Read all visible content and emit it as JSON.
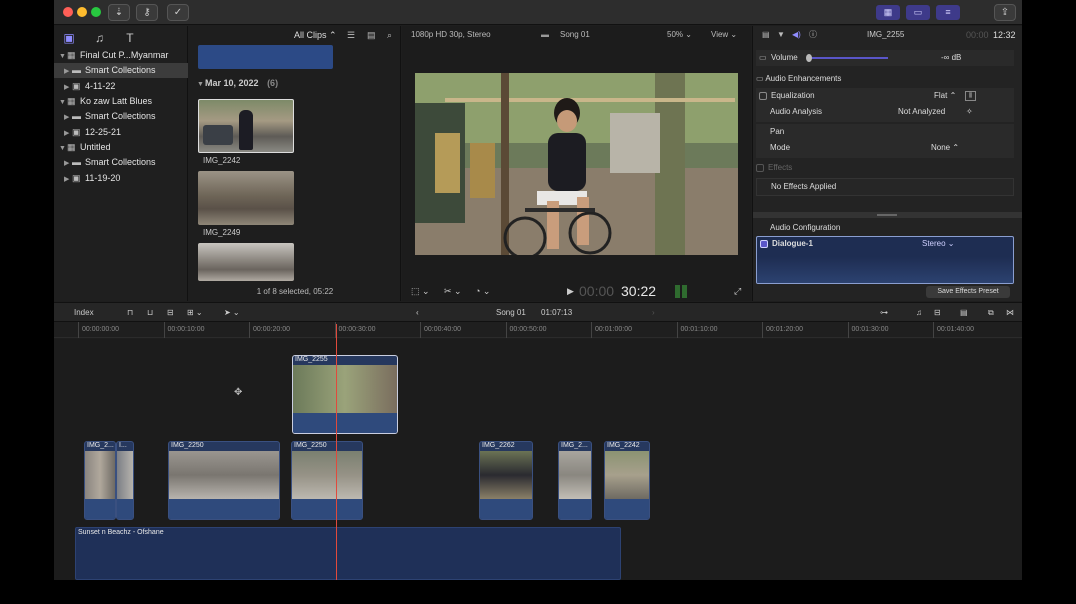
{
  "toolbar": {
    "import_icon": "download-arrow-icon",
    "keywords_icon": "key-icon",
    "background_tasks_icon": "check-circle-icon",
    "share_icon": "share-icon"
  },
  "libraries": {
    "rows": [
      {
        "label": "Final Cut P...Myanmar",
        "level": 0,
        "kind": "library"
      },
      {
        "label": "Smart Collections",
        "level": 1,
        "kind": "folder",
        "selected": true
      },
      {
        "label": "4-11-22",
        "level": 1,
        "kind": "event"
      },
      {
        "label": "Ko zaw Latt Blues",
        "level": 0,
        "kind": "library"
      },
      {
        "label": "Smart Collections",
        "level": 1,
        "kind": "folder"
      },
      {
        "label": "12-25-21",
        "level": 1,
        "kind": "event"
      },
      {
        "label": "Untitled",
        "level": 0,
        "kind": "library"
      },
      {
        "label": "Smart Collections",
        "level": 1,
        "kind": "folder"
      },
      {
        "label": "11-19-20",
        "level": 1,
        "kind": "event"
      }
    ]
  },
  "browser": {
    "filter_label": "All Clips",
    "date_group": "Mar 10, 2022",
    "date_count": "(6)",
    "clips": [
      "IMG_2242",
      "IMG_2249"
    ],
    "status": "1 of 8 selected, 05:22"
  },
  "viewer": {
    "format": "1080p HD 30p, Stereo",
    "project": "Song 01",
    "zoom": "50%",
    "view_label": "View",
    "timecode_dim": "00:00",
    "timecode": "30:22"
  },
  "inspector": {
    "clip_name": "IMG_2255",
    "duration_dim": "00:00",
    "duration": "12:32",
    "volume_label": "Volume",
    "volume_value": "-∞ dB",
    "enhancements_label": "Audio Enhancements",
    "equalization_label": "Equalization",
    "equalization_value": "Flat",
    "analysis_label": "Audio Analysis",
    "analysis_value": "Not Analyzed",
    "pan_label": "Pan",
    "mode_label": "Mode",
    "mode_value": "None",
    "effects_label": "Effects",
    "no_effects": "No Effects Applied",
    "config_label": "Audio Configuration",
    "role_label": "Dialogue-1",
    "role_value": "Stereo",
    "save_preset": "Save Effects Preset"
  },
  "timeline": {
    "index_label": "Index",
    "project": "Song 01",
    "duration": "01:07:13",
    "ruler": [
      "00:00:00:00",
      "00:00:10:00",
      "00:00:20:00",
      "00:00:30:00",
      "00:00:40:00",
      "00:00:50:00",
      "00:01:00:00",
      "00:01:10:00",
      "00:01:20:00",
      "00:01:30:00",
      "00:01:40:00"
    ],
    "connected_clip": "IMG_2255",
    "primary_clips": [
      "IMG_2...",
      "I...",
      "IMG_2250",
      "IMG_2250",
      "IMG_2262",
      "IMG_2...",
      "IMG_2242"
    ],
    "music_clip": "Sunset n Beachz - Ofshane"
  },
  "colors": {
    "accent": "#8f8cff",
    "clip_blue": "#26385e",
    "playhead": "#e14a3c"
  }
}
